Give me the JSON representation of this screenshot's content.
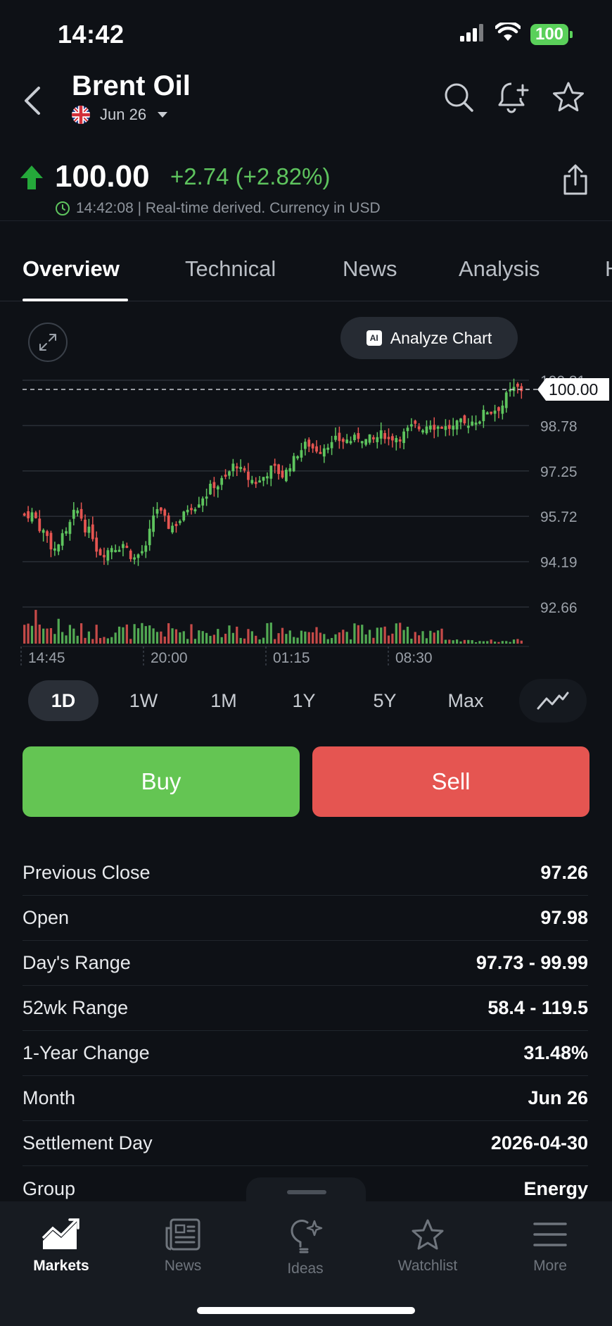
{
  "status_bar": {
    "time": "14:42",
    "battery": "100"
  },
  "header": {
    "title": "Brent Oil",
    "contract": "Jun 26"
  },
  "quote": {
    "price": "100.00",
    "change": "+2.74 (+2.82%)",
    "meta": "14:42:08 | Real-time derived. Currency in USD"
  },
  "tabs": [
    "Overview",
    "Technical",
    "News",
    "Analysis",
    "H"
  ],
  "chart_tools": {
    "analyze_label": "Analyze Chart",
    "ai_badge": "AI"
  },
  "chart_data": {
    "type": "candlestick",
    "y_ticks": [
      "100.31",
      "98.78",
      "97.25",
      "95.72",
      "94.19",
      "92.66"
    ],
    "ylim": [
      92.66,
      100.31
    ],
    "x_ticks": [
      "14:45",
      "20:00",
      "01:15",
      "08:30"
    ],
    "last_price_label": "100.00",
    "last_price": 100.0,
    "close_path": [
      95.8,
      95.2,
      94.6,
      95.1,
      95.9,
      95.2,
      94.5,
      94.7,
      94.8,
      94.3,
      94.6,
      96.0,
      95.4,
      95.6,
      96.1,
      96.4,
      96.8,
      97.0,
      97.5,
      97.0,
      96.9,
      97.3,
      97.1,
      97.6,
      98.1,
      98.0,
      98.2,
      98.3,
      98.3,
      98.4,
      98.3,
      98.5,
      98.4,
      98.6,
      98.7,
      98.9,
      98.8,
      98.7,
      98.8,
      99.0,
      99.3,
      99.4,
      99.9,
      100.0
    ],
    "legend": "none"
  },
  "timeframes": [
    "1D",
    "1W",
    "1M",
    "1Y",
    "5Y",
    "Max"
  ],
  "active_timeframe": "1D",
  "trade": {
    "buy": "Buy",
    "sell": "Sell"
  },
  "stats": [
    {
      "label": "Previous Close",
      "value": "97.26"
    },
    {
      "label": "Open",
      "value": "97.98"
    },
    {
      "label": "Day's Range",
      "value": "97.73 - 99.99"
    },
    {
      "label": "52wk Range",
      "value": "58.4 - 119.5"
    },
    {
      "label": "1-Year Change",
      "value": "31.48%"
    },
    {
      "label": "Month",
      "value": "Jun 26"
    },
    {
      "label": "Settlement Day",
      "value": "2026-04-30"
    },
    {
      "label": "Group",
      "value": "Energy"
    }
  ],
  "nav": [
    {
      "label": "Markets",
      "icon": "markets-icon"
    },
    {
      "label": "News",
      "icon": "news-icon"
    },
    {
      "label": "Ideas",
      "icon": "ideas-icon"
    },
    {
      "label": "Watchlist",
      "icon": "watchlist-icon"
    },
    {
      "label": "More",
      "icon": "more-icon"
    }
  ],
  "colors": {
    "up": "#5ec45e",
    "down": "#e55551",
    "background": "#0e1116"
  }
}
